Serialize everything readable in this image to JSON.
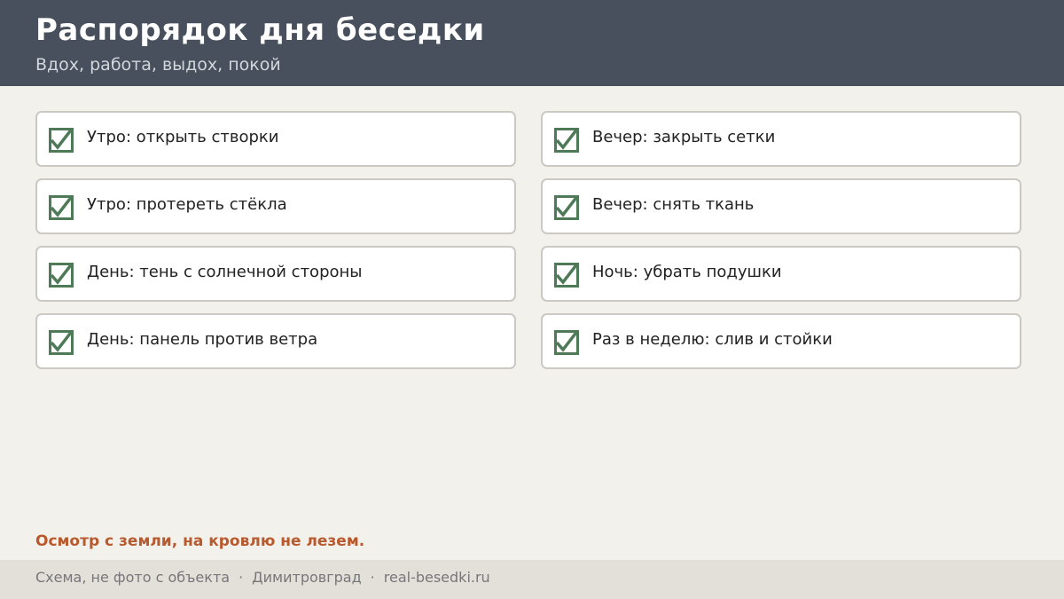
{
  "header": {
    "title": "Распорядок дня беседки",
    "subtitle": "Вдох, работа, выдох, покой"
  },
  "tasks": [
    {
      "label": "Утро: открыть створки",
      "checked": true
    },
    {
      "label": "Вечер: закрыть сетки",
      "checked": true
    },
    {
      "label": "Утро: протереть стёкла",
      "checked": true
    },
    {
      "label": "Вечер: снять ткань",
      "checked": true
    },
    {
      "label": "День: тень с солнечной стороны",
      "checked": true
    },
    {
      "label": "Ночь: убрать подушки",
      "checked": true
    },
    {
      "label": "День: панель против ветра",
      "checked": true
    },
    {
      "label": "Раз в неделю: слив и стойки",
      "checked": true
    }
  ],
  "note": "Осмотр с земли, на кровлю не лезем.",
  "footer": {
    "items": [
      "Схема, не фото с объекта",
      "Димитровград",
      "real-besedki.ru"
    ],
    "separator": "·"
  },
  "colors": {
    "header_bg": "#47505c",
    "page_bg": "#f3f1ec",
    "check": "#4e7a58",
    "note": "#b85a2e",
    "footer_bg": "#e3e0d9"
  },
  "icons": {
    "check": "checkbox-checked-icon"
  }
}
